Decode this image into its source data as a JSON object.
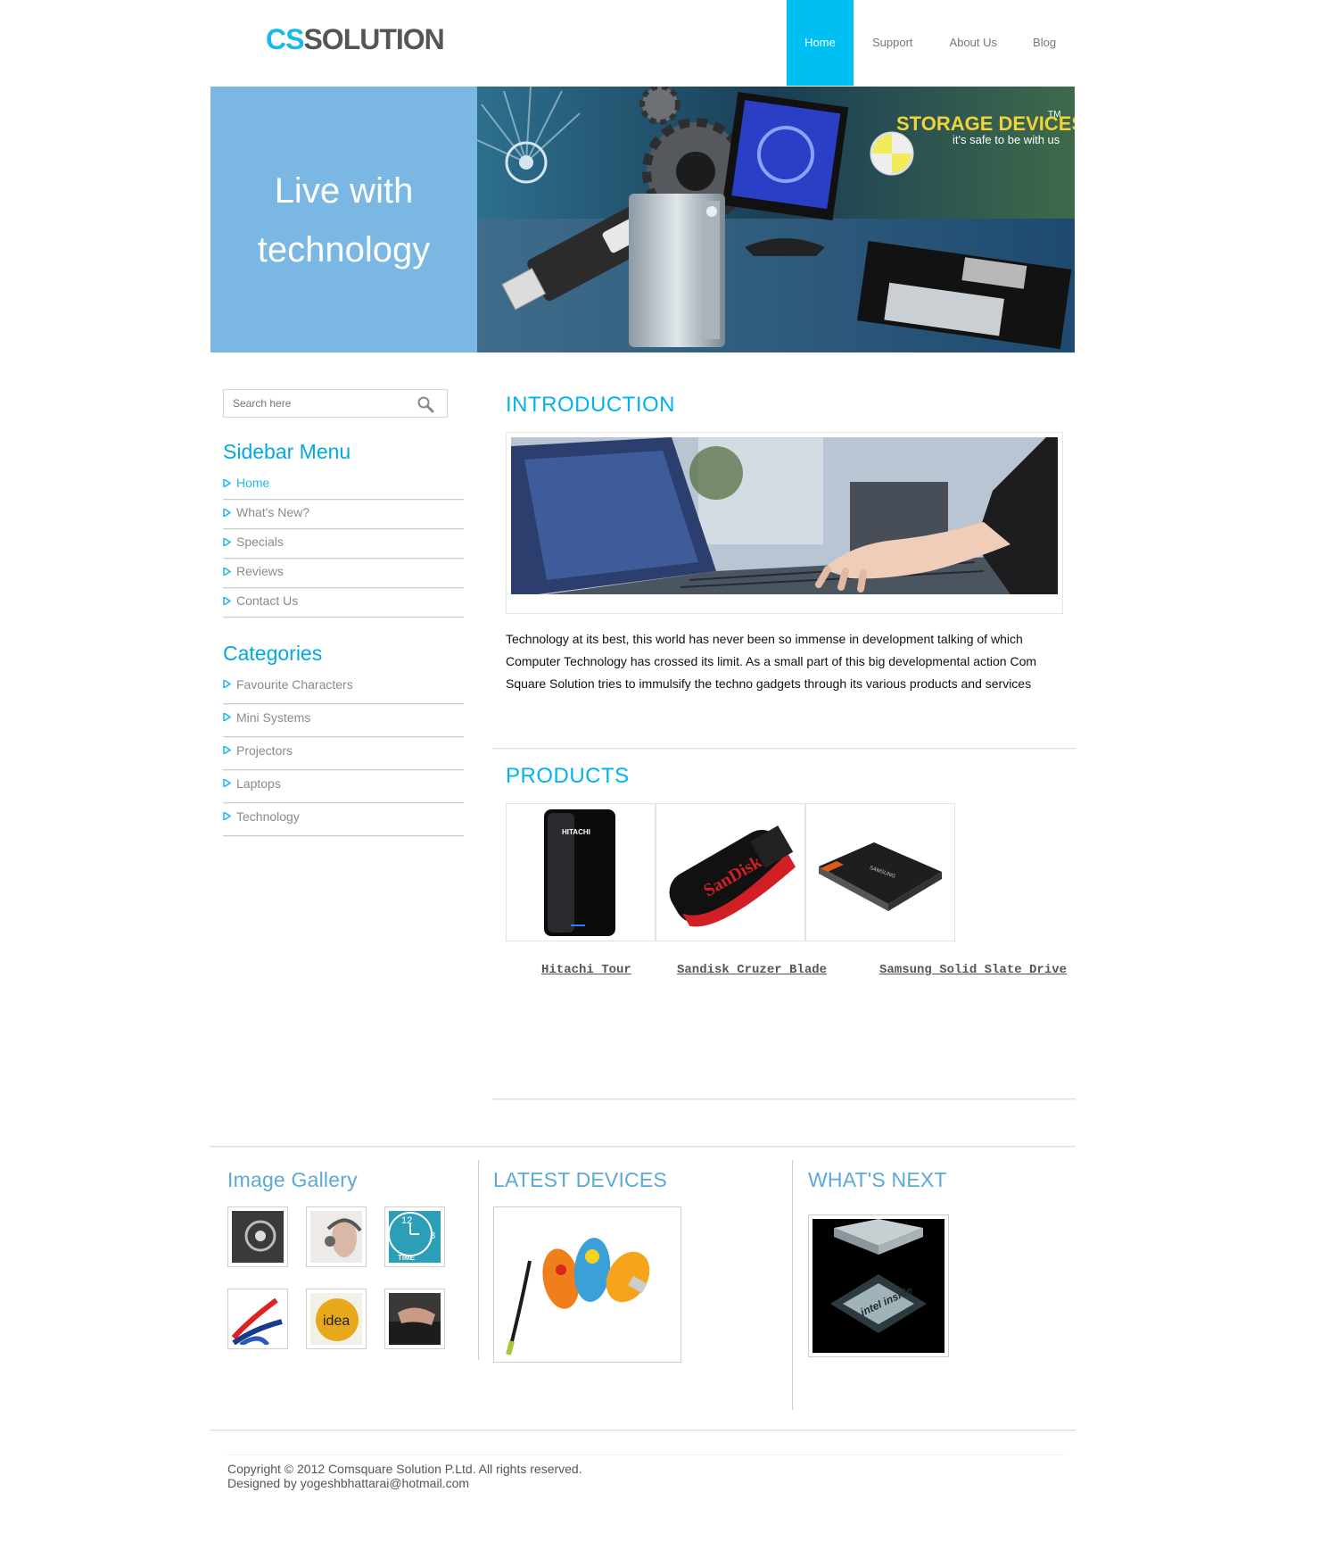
{
  "header": {
    "logo_cs": "CS",
    "logo_solution": "SOLUTION",
    "nav": [
      {
        "label": "Home",
        "active": true
      },
      {
        "label": "Support",
        "active": false
      },
      {
        "label": "About Us",
        "active": false
      },
      {
        "label": "Blog",
        "active": false
      }
    ]
  },
  "banner": {
    "headline_line1": "Live with",
    "headline_line2": "technology",
    "storage_title": "STORAGE DEVICES",
    "storage_tm": "TM",
    "storage_tagline": "it's safe to be with us"
  },
  "sidebar": {
    "search_placeholder": "Search here",
    "menu_title": "Sidebar Menu",
    "menu": [
      "Home",
      "What's New?",
      "Specials",
      "Reviews",
      "Contact Us"
    ],
    "categories_title": "Categories",
    "categories": [
      "Favourite Characters",
      "Mini Systems",
      "Projectors",
      "Laptops",
      "Technology"
    ]
  },
  "main": {
    "intro_title": "INTRODUCTION",
    "intro_text": "Technology at its best, this world has never been so immense in development talking of which Computer Technology has crossed its limit. As a small part of this big developmental action Com Square Solution tries to immulsify the techno gadgets through its various products and services",
    "products_title": "PRODUCTS",
    "products": [
      {
        "name": "Hitachi Tour",
        "brand_text": "HITACHI"
      },
      {
        "name": "Sandisk Cruzer Blade",
        "brand_text": "SanDisk"
      },
      {
        "name": "Samsung Solid Slate Drive",
        "brand_text": "SAMSUNG"
      }
    ]
  },
  "bottom": {
    "gallery_title": "Image Gallery",
    "gallery_texts": {
      "clock_top": "12",
      "clock_right": "3",
      "clock_label": "TIME",
      "idea": "idea"
    },
    "latest_title": "LATEST DEVICES",
    "next_title": "WHAT'S NEXT",
    "chip_text": "intel inside"
  },
  "footer": {
    "copyright": "Copyright © 2012 Comsquare Solution P.Ltd. All rights reserved.",
    "designed": "Designed by yogeshbhattarai@hotmail.com"
  },
  "colors": {
    "accent": "#00bff3",
    "banner_blue": "#7ab8e3",
    "heading_blue": "#00b3ee",
    "bottom_heading": "#5aa9d8"
  }
}
